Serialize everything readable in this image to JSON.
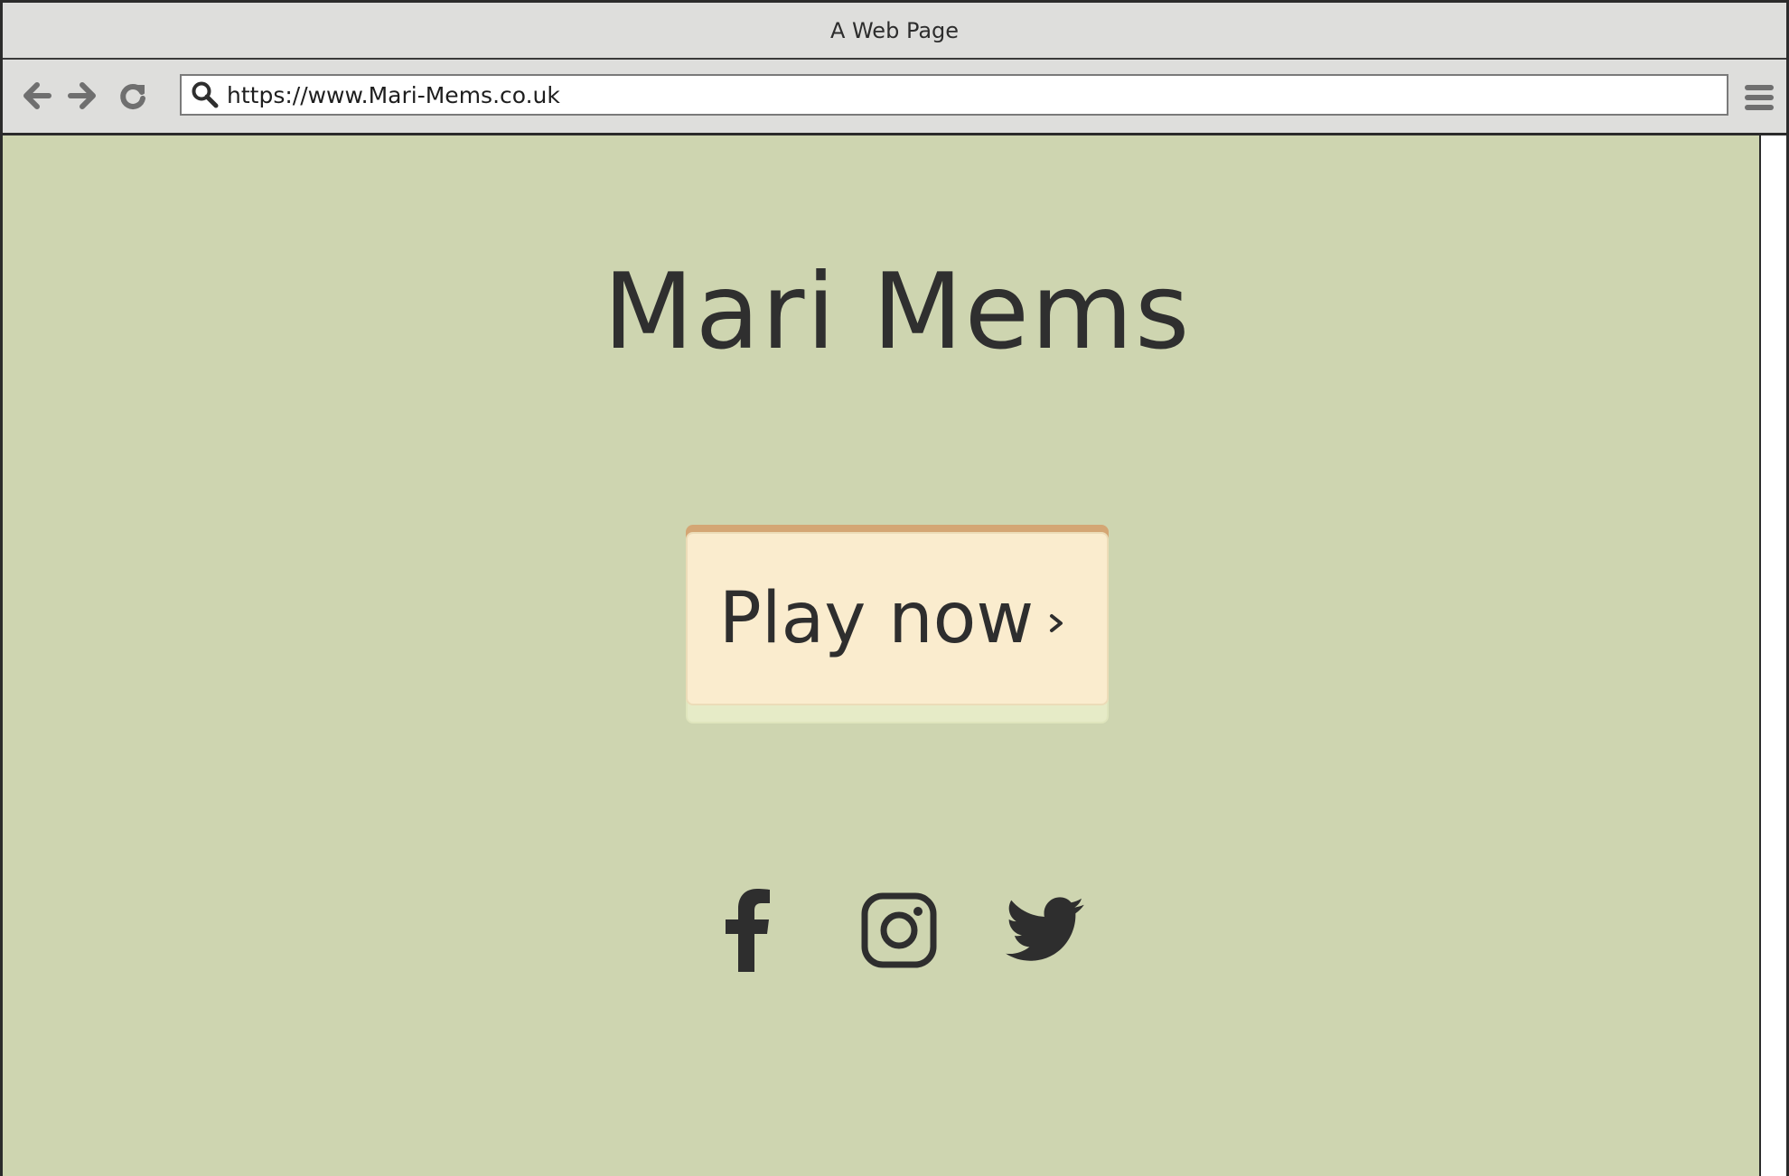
{
  "window": {
    "title": "A Web Page"
  },
  "toolbar": {
    "back_icon": "arrow-left-icon",
    "forward_icon": "arrow-right-icon",
    "reload_icon": "reload-icon",
    "menu_icon": "hamburger-menu-icon",
    "address": {
      "search_icon": "search-icon",
      "value": "https://www.Mari-Mems.co.uk"
    }
  },
  "page": {
    "title": "Mari Mems",
    "play_button": {
      "label": "Play now",
      "chevron_icon": "chevron-right-icon"
    },
    "social": [
      {
        "icon": "facebook-icon"
      },
      {
        "icon": "instagram-icon"
      },
      {
        "icon": "twitter-icon"
      }
    ]
  },
  "colors": {
    "page_background": "#ced5b0",
    "chrome_background": "#dededc",
    "button_face": "#faecce",
    "button_top_accent": "#d4a674",
    "text": "#2f2f2f",
    "icon_gray": "#6f6f6f"
  }
}
